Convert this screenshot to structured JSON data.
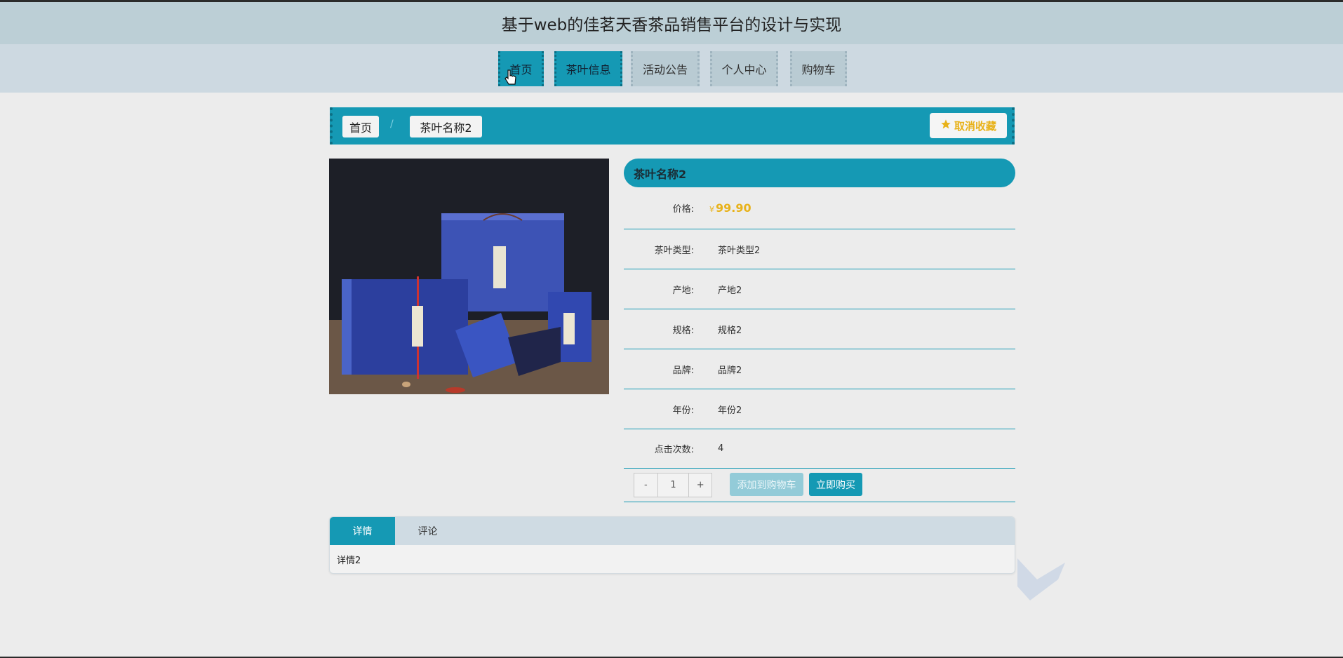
{
  "header": {
    "title": "基于web的佳茗天香茶品销售平台的设计与实现"
  },
  "nav": {
    "items": [
      {
        "label": "首页"
      },
      {
        "label": "茶叶信息"
      },
      {
        "label": "活动公告"
      },
      {
        "label": "个人中心"
      },
      {
        "label": "购物车"
      }
    ],
    "active": "茶叶信息"
  },
  "breadcrumb": {
    "home": "首页",
    "separator": "/",
    "current": "茶叶名称2"
  },
  "favorite": {
    "label": "取消收藏",
    "icon": "star-icon"
  },
  "product": {
    "name": "茶叶名称2",
    "currency": "¥",
    "price": "99.90",
    "fields": [
      {
        "label": "价格:",
        "value": ""
      },
      {
        "label": "茶叶类型:",
        "value": "茶叶类型2"
      },
      {
        "label": "产地:",
        "value": "产地2"
      },
      {
        "label": "规格:",
        "value": "规格2"
      },
      {
        "label": "品牌:",
        "value": "品牌2"
      },
      {
        "label": "年份:",
        "value": "年份2"
      },
      {
        "label": "点击次数:",
        "value": "4"
      }
    ]
  },
  "purchase": {
    "minus": "-",
    "quantity": "1",
    "plus": "+",
    "add_to_cart": "添加到购物车",
    "buy_now": "立即购买"
  },
  "tabs": {
    "items": [
      {
        "label": "详情"
      },
      {
        "label": "评论"
      }
    ],
    "active": "详情",
    "content": "详情2"
  },
  "colors": {
    "accent": "#1599b4",
    "price": "#e8b21a",
    "header_bg": "#bccfd6"
  }
}
